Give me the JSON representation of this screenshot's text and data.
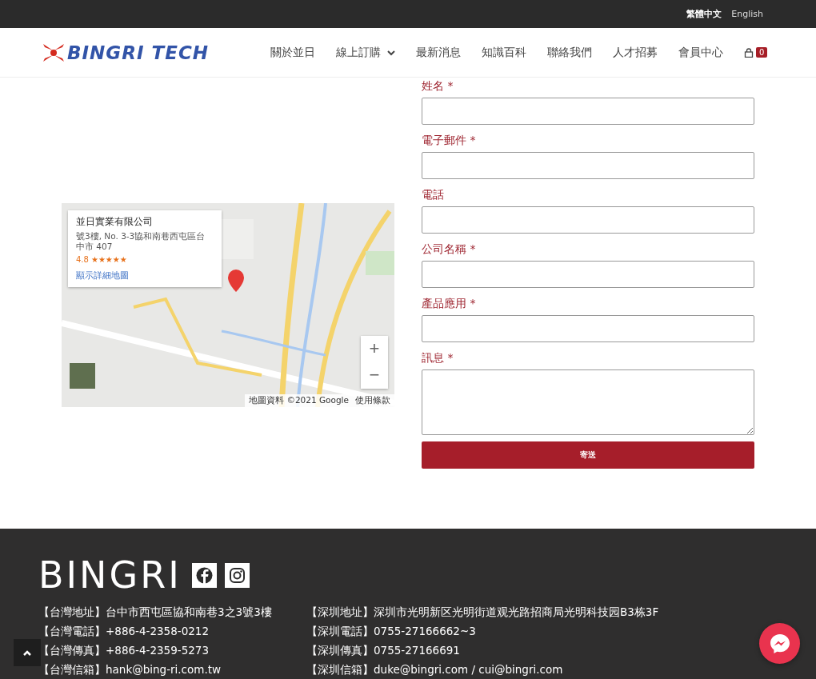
{
  "top_bar": {
    "languages": [
      {
        "label": "繁體中文",
        "selected": true
      },
      {
        "label": "English",
        "selected": false
      }
    ]
  },
  "header": {
    "logo": "BINGRI TECH",
    "nav": [
      {
        "label": "關於並日",
        "has_dropdown": false
      },
      {
        "label": "線上訂購",
        "has_dropdown": true
      },
      {
        "label": "最新消息",
        "has_dropdown": false
      },
      {
        "label": "知識百科",
        "has_dropdown": false
      },
      {
        "label": "聯絡我們",
        "has_dropdown": false
      },
      {
        "label": "人才招募",
        "has_dropdown": false
      },
      {
        "label": "會員中心",
        "has_dropdown": false
      }
    ],
    "cart_count": "0"
  },
  "map": {
    "kind": "picture",
    "info_card": {
      "title": "並日實業有限公司",
      "address": "號3樓, No. 3-3協和南巷西屯區台中市 407",
      "rating": "4.8",
      "stars": 5,
      "link": "顯示詳細地圖"
    },
    "zoom_in": "+",
    "zoom_out": "−",
    "attribution": "地圖資料 ©2021 Google",
    "terms": "使用條款"
  },
  "form": {
    "fields": [
      {
        "label": "姓名",
        "required": true,
        "kind": "input"
      },
      {
        "label": "電子郵件",
        "required": true,
        "kind": "input"
      },
      {
        "label": "電話",
        "required": false,
        "kind": "input"
      },
      {
        "label": "公司名稱",
        "required": true,
        "kind": "input"
      },
      {
        "label": "產品應用",
        "required": true,
        "kind": "input"
      },
      {
        "label": "訊息",
        "required": true,
        "kind": "textarea"
      }
    ],
    "required_mark": "*",
    "submit": "寄送"
  },
  "footer": {
    "brand": "BINGRI",
    "columns": [
      [
        {
          "label": "【台灣地址】",
          "value": "台中市西屯區協和南巷3之3號3樓"
        },
        {
          "label": "【台灣電話】",
          "value": "+886-4-2358-0212"
        },
        {
          "label": "【台灣傳真】",
          "value": "+886-4-2359-5273"
        },
        {
          "label": "【台灣信箱】",
          "value": "hank@bing-ri.com.tw"
        }
      ],
      [
        {
          "label": "【深圳地址】",
          "value": "深圳市光明新区光明街道观光路招商局光明科技园B3栋3F"
        },
        {
          "label": "【深圳電話】",
          "value": "0755-27166662~3"
        },
        {
          "label": "【深圳傳真】",
          "value": "0755-27166691"
        },
        {
          "label": "【深圳信箱】",
          "value": "duke@bingri.com / cui@bingri.com"
        }
      ]
    ]
  }
}
